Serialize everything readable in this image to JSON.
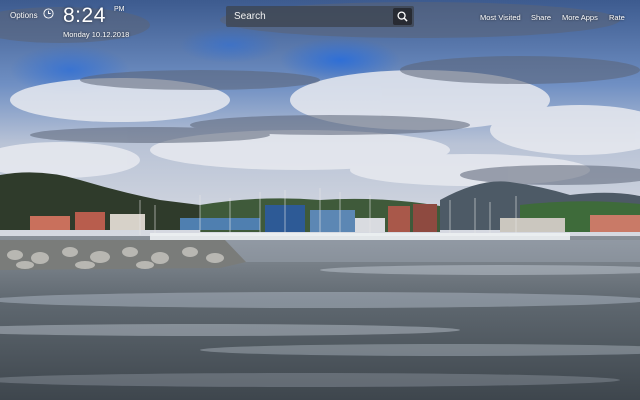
{
  "header": {
    "options_label": "Options",
    "time": "8:24",
    "meridiem": "PM",
    "date": "Monday  10.12.2018"
  },
  "search": {
    "placeholder": "Search"
  },
  "nav": {
    "most_visited": "Most Visited",
    "share": "Share",
    "more_apps": "More Apps",
    "rate": "Rate"
  },
  "icons": {
    "clock": "clock-icon",
    "search": "search-icon"
  },
  "colors": {
    "search_bg": "#3c424c",
    "text": "#ffffff"
  }
}
